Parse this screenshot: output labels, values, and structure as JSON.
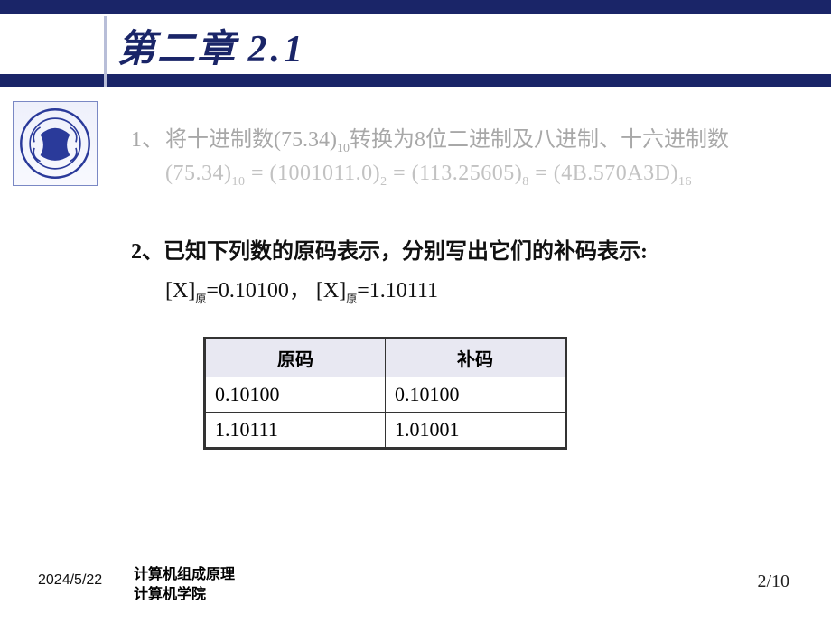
{
  "header": {
    "chapter_cn": "第二章",
    "chapter_num": "2.1"
  },
  "q1": {
    "prefix": "1、",
    "text_a": "将十进制数(75.34)",
    "sub_a": "10",
    "text_b": "转换为8位二进制及八进制、十六进制数",
    "eq": {
      "p1": "(75.34)",
      "s1": "10",
      "p2": " = (1001011.0)",
      "s2": "2",
      "p3": " = (113.25605)",
      "s3": "8",
      "p4": "  = (4B.570A3D)",
      "s4": "16"
    }
  },
  "q2": {
    "prefix": "2、",
    "text": "已知下列数的原码表示，分别写出它们的补码表示:",
    "eq": {
      "x1_pre": "[X]",
      "x1_sub": "原",
      "x1_val": "=0.10100，",
      "gap": "   ",
      "x2_pre": "[X]",
      "x2_sub": "原",
      "x2_val": "=1.10111"
    }
  },
  "table": {
    "headers": [
      "原码",
      "补码"
    ],
    "rows": [
      [
        "0.10100",
        "0.10100"
      ],
      [
        "1.10111",
        "1.01001"
      ]
    ]
  },
  "footer": {
    "date": "2024/5/22",
    "course": "计算机组成原理",
    "dept": "计算机学院",
    "page": "2/10"
  }
}
